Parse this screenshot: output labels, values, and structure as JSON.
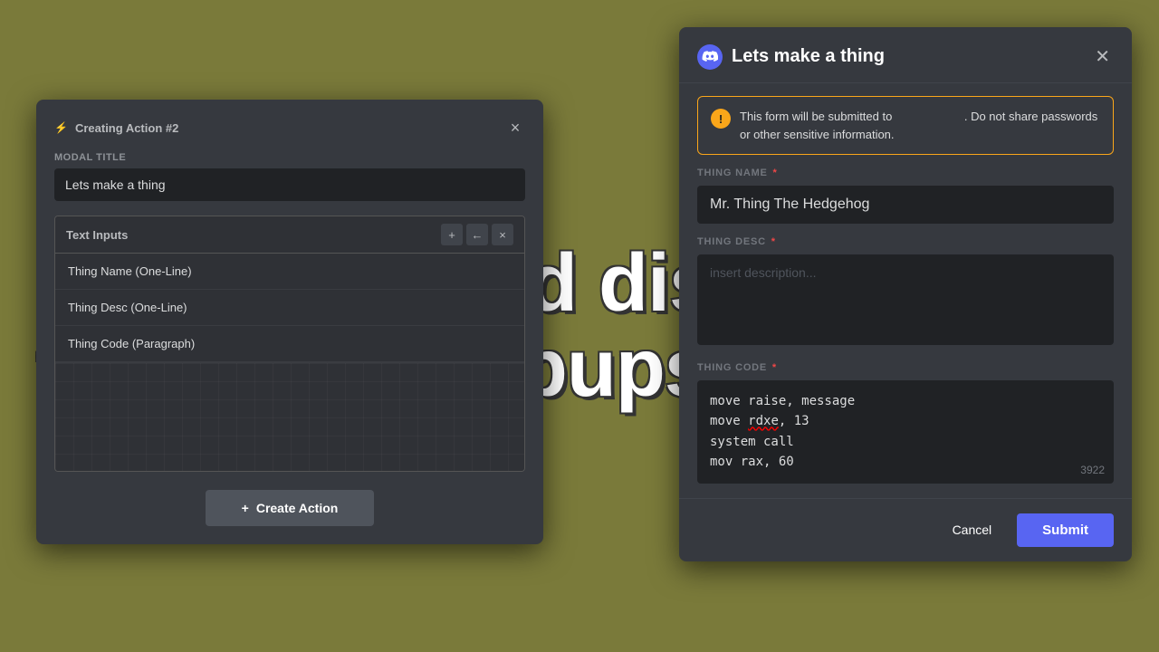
{
  "background": {
    "color": "#7a7a3a"
  },
  "bg_text": {
    "line1": "Configure and display",
    "line2": "text-input popups!"
  },
  "left_modal": {
    "header_title": "Creating Action #2",
    "close_label": "×",
    "modal_title_label": "Modal Title",
    "modal_title_value": "Lets make a thing",
    "text_inputs_label": "Text Inputs",
    "add_btn_label": "+",
    "move_btn_label": "←",
    "delete_btn_label": "×",
    "rows": [
      "Thing Name (One-Line)",
      "Thing Desc (One-Line)",
      "Thing Code (Paragraph)"
    ],
    "create_action_label": "Create Action",
    "create_plus": "+"
  },
  "right_modal": {
    "title": "Lets make a thing",
    "close_label": "✕",
    "warning_text_part1": "This form will be submitted to",
    "warning_text_blank": "        ",
    "warning_text_part2": ". Do not share passwords or other sensitive information.",
    "warning_icon": "!",
    "fields": [
      {
        "label": "THING NAME",
        "required": true,
        "type": "input",
        "value": "Mr. Thing The Hedgehog",
        "placeholder": ""
      },
      {
        "label": "THING DESC",
        "required": true,
        "type": "textarea",
        "value": "",
        "placeholder": "insert description..."
      },
      {
        "label": "THING CODE",
        "required": true,
        "type": "code",
        "lines": [
          "move raise, message",
          "move rdxe, 13",
          "system call",
          "mov rax, 60"
        ],
        "char_count": "3922"
      }
    ],
    "cancel_label": "Cancel",
    "submit_label": "Submit"
  }
}
